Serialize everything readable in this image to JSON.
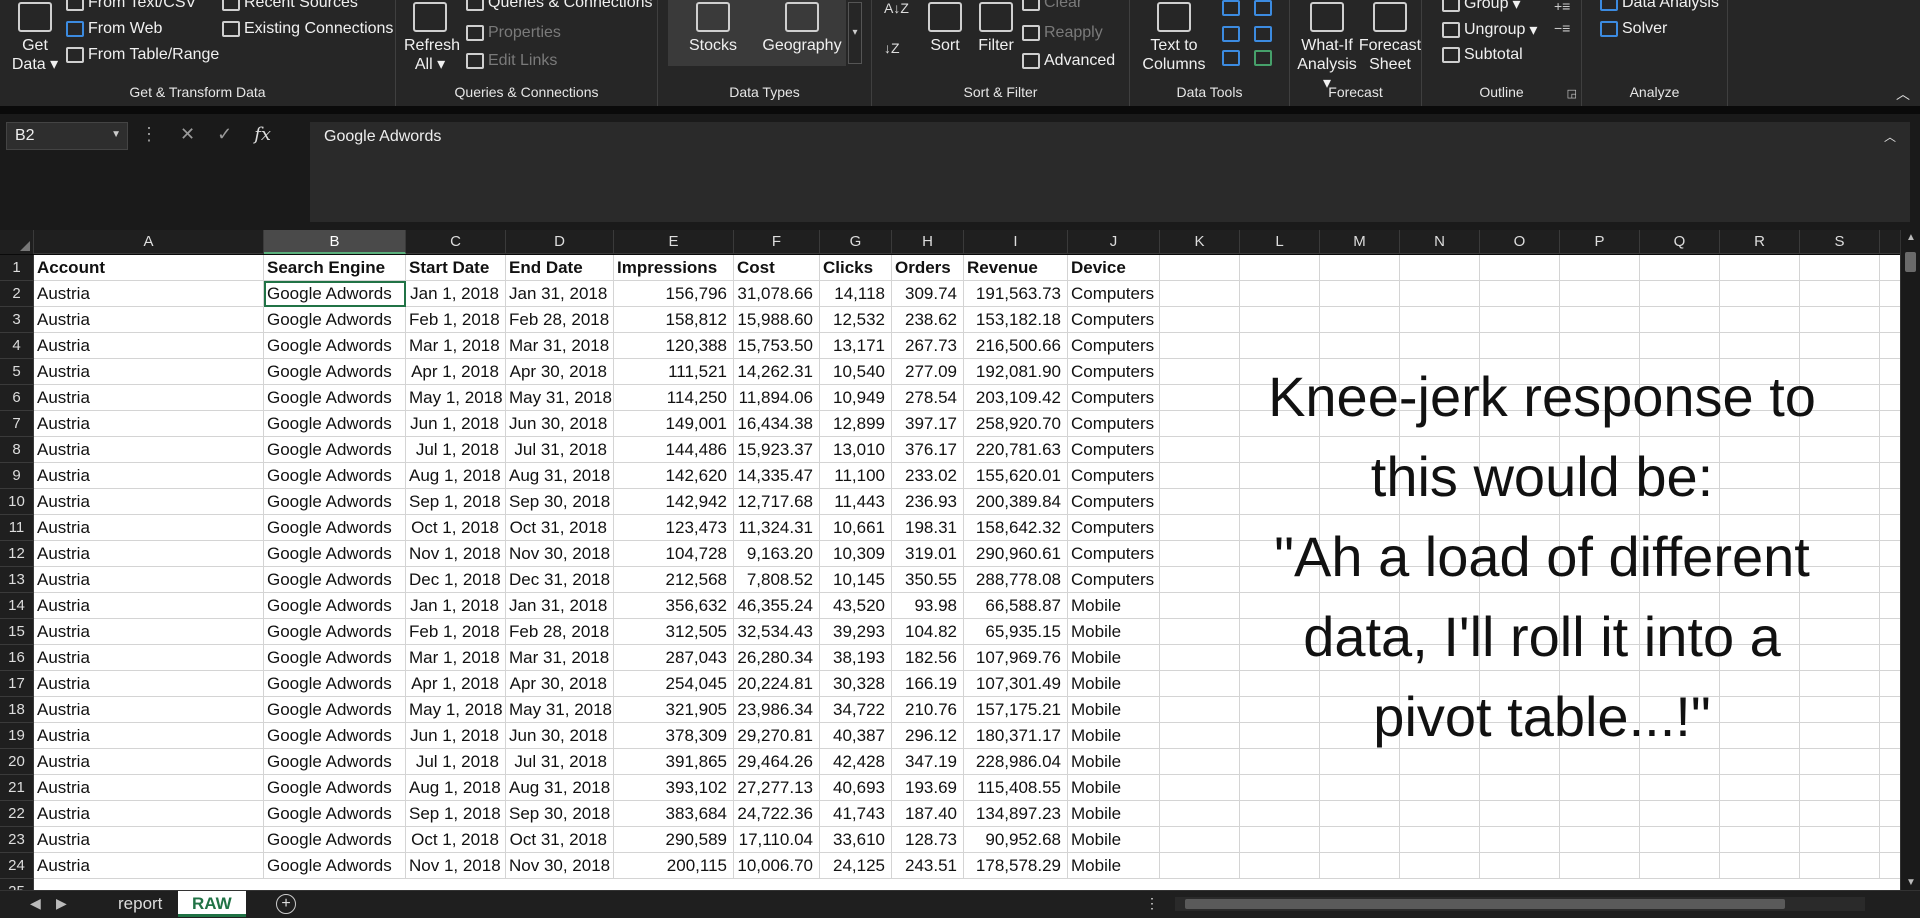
{
  "ribbon": {
    "get_data": {
      "line1": "Get",
      "line2": "Data ▾"
    },
    "from_text": "From Text/CSV",
    "from_web": "From Web",
    "from_table": "From Table/Range",
    "recent_sources": "Recent Sources",
    "existing_connections": "Existing Connections",
    "group_get": "Get & Transform Data",
    "refresh": {
      "line1": "Refresh",
      "line2": "All ▾"
    },
    "queries_connections": "Queries & Connections",
    "properties": "Properties",
    "edit_links": "Edit Links",
    "group_queries": "Queries & Connections",
    "stocks": "Stocks",
    "geography": "Geography",
    "group_types": "Data Types",
    "sort": "Sort",
    "filter": "Filter",
    "clear": "Clear",
    "reapply": "Reapply",
    "advanced": "Advanced",
    "group_sort": "Sort & Filter",
    "text_to_columns": {
      "line1": "Text to",
      "line2": "Columns"
    },
    "group_tools": "Data Tools",
    "what_if": {
      "line1": "What-If",
      "line2": "Analysis ▾"
    },
    "forecast_sheet": {
      "line1": "Forecast",
      "line2": "Sheet"
    },
    "group_forecast": "Forecast",
    "group_btn": "Group",
    "ungroup": "Ungroup",
    "subtotal": "Subtotal",
    "group_outline": "Outline",
    "data_analysis": "Data Analysis",
    "solver": "Solver",
    "group_analyze": "Analyze"
  },
  "formula_bar": {
    "name_box": "B2",
    "formula": "Google Adwords"
  },
  "columns": [
    "A",
    "B",
    "C",
    "D",
    "E",
    "F",
    "G",
    "H",
    "I",
    "J",
    "K",
    "L",
    "M",
    "N",
    "O",
    "P",
    "Q",
    "R",
    "S"
  ],
  "selected_column": "B",
  "headers": [
    "Account",
    "Search Engine",
    "Start Date",
    "End Date",
    "Impressions",
    "Cost",
    "Clicks",
    "Orders",
    "Revenue",
    "Device"
  ],
  "rows": [
    [
      "Austria",
      "Google Adwords",
      "Jan 1, 2018",
      "Jan 31, 2018",
      "156,796",
      "31,078.66",
      "14,118",
      "309.74",
      "191,563.73",
      "Computers"
    ],
    [
      "Austria",
      "Google Adwords",
      "Feb 1, 2018",
      "Feb 28, 2018",
      "158,812",
      "15,988.60",
      "12,532",
      "238.62",
      "153,182.18",
      "Computers"
    ],
    [
      "Austria",
      "Google Adwords",
      "Mar 1, 2018",
      "Mar 31, 2018",
      "120,388",
      "15,753.50",
      "13,171",
      "267.73",
      "216,500.66",
      "Computers"
    ],
    [
      "Austria",
      "Google Adwords",
      "Apr 1, 2018",
      "Apr 30, 2018",
      "111,521",
      "14,262.31",
      "10,540",
      "277.09",
      "192,081.90",
      "Computers"
    ],
    [
      "Austria",
      "Google Adwords",
      "May 1, 2018",
      "May 31, 2018",
      "114,250",
      "11,894.06",
      "10,949",
      "278.54",
      "203,109.42",
      "Computers"
    ],
    [
      "Austria",
      "Google Adwords",
      "Jun 1, 2018",
      "Jun 30, 2018",
      "149,001",
      "16,434.38",
      "12,899",
      "397.17",
      "258,920.70",
      "Computers"
    ],
    [
      "Austria",
      "Google Adwords",
      "Jul 1, 2018",
      "Jul 31, 2018",
      "144,486",
      "15,923.37",
      "13,010",
      "376.17",
      "220,781.63",
      "Computers"
    ],
    [
      "Austria",
      "Google Adwords",
      "Aug 1, 2018",
      "Aug 31, 2018",
      "142,620",
      "14,335.47",
      "11,100",
      "233.02",
      "155,620.01",
      "Computers"
    ],
    [
      "Austria",
      "Google Adwords",
      "Sep 1, 2018",
      "Sep 30, 2018",
      "142,942",
      "12,717.68",
      "11,443",
      "236.93",
      "200,389.84",
      "Computers"
    ],
    [
      "Austria",
      "Google Adwords",
      "Oct 1, 2018",
      "Oct 31, 2018",
      "123,473",
      "11,324.31",
      "10,661",
      "198.31",
      "158,642.32",
      "Computers"
    ],
    [
      "Austria",
      "Google Adwords",
      "Nov 1, 2018",
      "Nov 30, 2018",
      "104,728",
      "9,163.20",
      "10,309",
      "319.01",
      "290,960.61",
      "Computers"
    ],
    [
      "Austria",
      "Google Adwords",
      "Dec 1, 2018",
      "Dec 31, 2018",
      "212,568",
      "7,808.52",
      "10,145",
      "350.55",
      "288,778.08",
      "Computers"
    ],
    [
      "Austria",
      "Google Adwords",
      "Jan 1, 2018",
      "Jan 31, 2018",
      "356,632",
      "46,355.24",
      "43,520",
      "93.98",
      "66,588.87",
      "Mobile"
    ],
    [
      "Austria",
      "Google Adwords",
      "Feb 1, 2018",
      "Feb 28, 2018",
      "312,505",
      "32,534.43",
      "39,293",
      "104.82",
      "65,935.15",
      "Mobile"
    ],
    [
      "Austria",
      "Google Adwords",
      "Mar 1, 2018",
      "Mar 31, 2018",
      "287,043",
      "26,280.34",
      "38,193",
      "182.56",
      "107,969.76",
      "Mobile"
    ],
    [
      "Austria",
      "Google Adwords",
      "Apr 1, 2018",
      "Apr 30, 2018",
      "254,045",
      "20,224.81",
      "30,328",
      "166.19",
      "107,301.49",
      "Mobile"
    ],
    [
      "Austria",
      "Google Adwords",
      "May 1, 2018",
      "May 31, 2018",
      "321,905",
      "23,986.34",
      "34,722",
      "210.76",
      "157,175.21",
      "Mobile"
    ],
    [
      "Austria",
      "Google Adwords",
      "Jun 1, 2018",
      "Jun 30, 2018",
      "378,309",
      "29,270.81",
      "40,387",
      "296.12",
      "180,371.17",
      "Mobile"
    ],
    [
      "Austria",
      "Google Adwords",
      "Jul 1, 2018",
      "Jul 31, 2018",
      "391,865",
      "29,464.26",
      "42,428",
      "347.19",
      "228,986.04",
      "Mobile"
    ],
    [
      "Austria",
      "Google Adwords",
      "Aug 1, 2018",
      "Aug 31, 2018",
      "393,102",
      "27,277.13",
      "40,693",
      "193.69",
      "115,408.55",
      "Mobile"
    ],
    [
      "Austria",
      "Google Adwords",
      "Sep 1, 2018",
      "Sep 30, 2018",
      "383,684",
      "24,722.36",
      "41,743",
      "187.40",
      "134,897.23",
      "Mobile"
    ],
    [
      "Austria",
      "Google Adwords",
      "Oct 1, 2018",
      "Oct 31, 2018",
      "290,589",
      "17,110.04",
      "33,610",
      "128.73",
      "90,952.68",
      "Mobile"
    ],
    [
      "Austria",
      "Google Adwords",
      "Nov 1, 2018",
      "Nov 30, 2018",
      "200,115",
      "10,006.70",
      "24,125",
      "243.51",
      "178,578.29",
      "Mobile"
    ]
  ],
  "callout": [
    "Knee-jerk response to",
    "this would be:",
    "\"Ah a load of different",
    "data, I'll roll it into a",
    "pivot table...!\""
  ],
  "sheet_tabs": [
    "report",
    "RAW"
  ],
  "active_tab": "RAW"
}
